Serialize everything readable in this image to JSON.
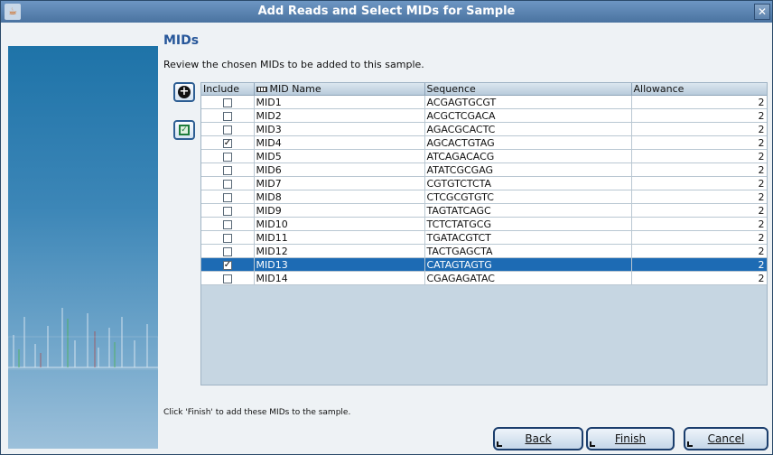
{
  "window": {
    "title": "Add Reads and Select MIDs for Sample"
  },
  "page": {
    "heading": "MIDs",
    "subtitle": "Review the chosen MIDs to be added to this sample.",
    "footer": "Click 'Finish' to add these MIDs to the sample."
  },
  "table": {
    "columns": [
      "Include",
      "MID Name",
      "Sequence",
      "Allowance"
    ],
    "rows": [
      {
        "include": false,
        "name": "MID1",
        "sequence": "ACGAGTGCGT",
        "allowance": "2"
      },
      {
        "include": false,
        "name": "MID2",
        "sequence": "ACGCTCGACA",
        "allowance": "2"
      },
      {
        "include": false,
        "name": "MID3",
        "sequence": "AGACGCACTC",
        "allowance": "2"
      },
      {
        "include": true,
        "name": "MID4",
        "sequence": "AGCACTGTAG",
        "allowance": "2"
      },
      {
        "include": false,
        "name": "MID5",
        "sequence": "ATCAGACACG",
        "allowance": "2"
      },
      {
        "include": false,
        "name": "MID6",
        "sequence": "ATATCGCGAG",
        "allowance": "2"
      },
      {
        "include": false,
        "name": "MID7",
        "sequence": "CGTGTCTCTA",
        "allowance": "2"
      },
      {
        "include": false,
        "name": "MID8",
        "sequence": "CTCGCGTGTC",
        "allowance": "2"
      },
      {
        "include": false,
        "name": "MID9",
        "sequence": "TAGTATCAGC",
        "allowance": "2"
      },
      {
        "include": false,
        "name": "MID10",
        "sequence": "TCTCTATGCG",
        "allowance": "2"
      },
      {
        "include": false,
        "name": "MID11",
        "sequence": "TGATACGTCT",
        "allowance": "2"
      },
      {
        "include": false,
        "name": "MID12",
        "sequence": "TACTGAGCTA",
        "allowance": "2"
      },
      {
        "include": true,
        "name": "MID13",
        "sequence": "CATAGTAGTG",
        "allowance": "2",
        "selected": true
      },
      {
        "include": false,
        "name": "MID14",
        "sequence": "CGAGAGATAC",
        "allowance": "2"
      }
    ]
  },
  "buttons": {
    "back": "Back",
    "finish": "Finish",
    "cancel": "Cancel"
  },
  "icons": {
    "app": "java-icon",
    "close": "close-icon",
    "add": "add-icon",
    "select_all": "select-all-icon"
  },
  "colors": {
    "selection": "#1d6bb4",
    "heading": "#27579a",
    "titlebar": "#4a73a0"
  }
}
